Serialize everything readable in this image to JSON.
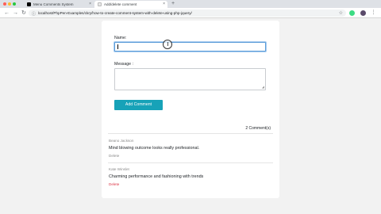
{
  "browser": {
    "tabs": [
      {
        "title": "Menu Comments System",
        "active": false,
        "favicon_color": "#000000"
      },
      {
        "title": "Add/delete comment",
        "active": true,
        "favicon_color": "#e8e8e8"
      }
    ],
    "new_tab_glyph": "+",
    "close_glyph": "×",
    "url": "localhost/PhpPen-Examples/ckry/how-to-create-comment-system-with-delete-using-php-jquery/",
    "nav": {
      "back": "←",
      "forward": "→",
      "reload": "↻"
    },
    "star_glyph": "☆",
    "lock_glyph": "ⓘ"
  },
  "form": {
    "name_label": "Name:",
    "message_label": "Message :",
    "name_value": "",
    "message_value": "",
    "submit_label": "Add Comment",
    "button_color": "#17a2b8"
  },
  "comments_count": "2 Comment(s)",
  "comments": [
    {
      "author": "Beano Jackson",
      "text": "Mind blowing outcome looks really professional.",
      "delete_label": "Delete"
    },
    {
      "author": "Kate Winslet",
      "text": "Charming performance and fashioning with trends",
      "delete_label": "Delete"
    }
  ],
  "colors": {
    "accent": "#17a2b8",
    "danger": "#dc3545"
  }
}
